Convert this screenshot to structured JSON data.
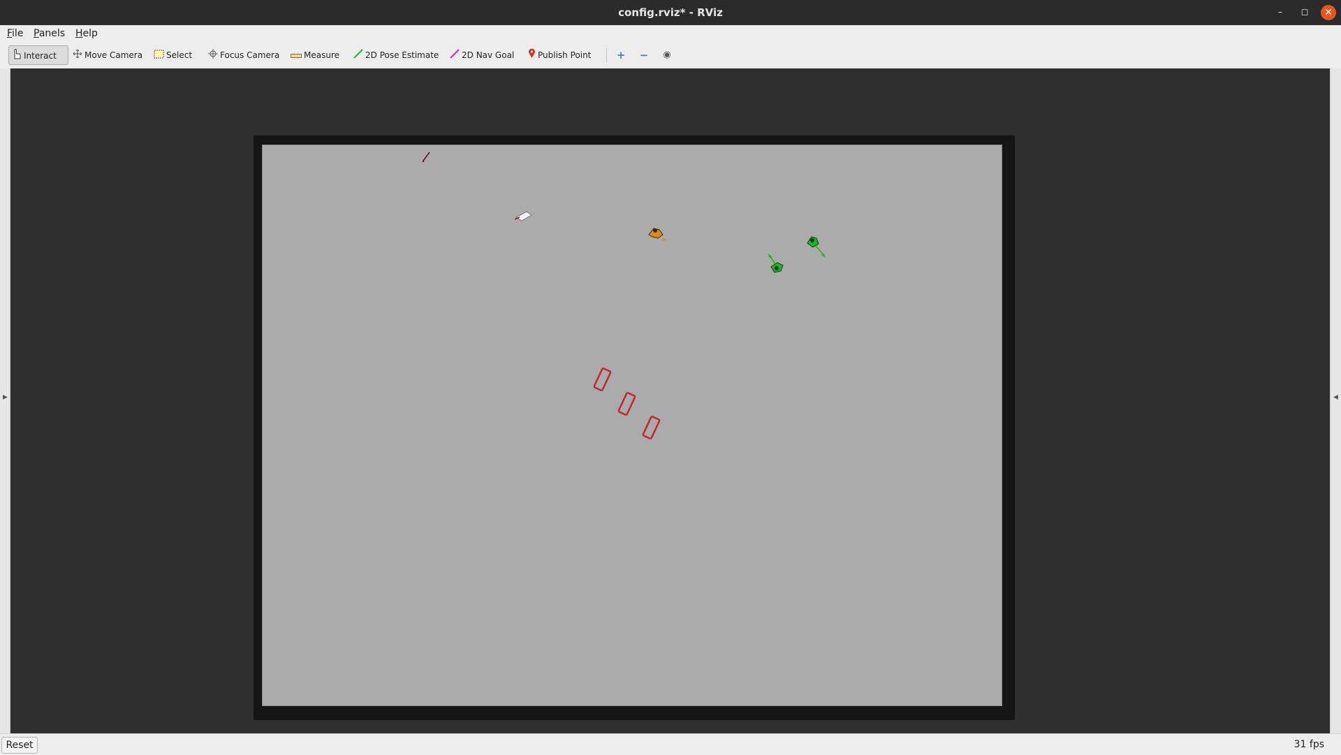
{
  "window": {
    "title": "config.rviz* - RViz",
    "minimize": "–",
    "maximize": "◻",
    "close": "✕"
  },
  "menu": [
    {
      "label": "File"
    },
    {
      "label": "Panels"
    },
    {
      "label": "Help"
    }
  ],
  "toolbar": {
    "tools": [
      {
        "label": "Interact",
        "icon": "hand-pointer-icon",
        "active": true
      },
      {
        "label": "Move Camera",
        "icon": "move-arrows-icon"
      },
      {
        "label": "Select",
        "icon": "select-rectangle-icon"
      },
      {
        "label": "Focus Camera",
        "icon": "crosshair-icon"
      },
      {
        "label": "Measure",
        "icon": "ruler-icon"
      },
      {
        "label": "2D Pose Estimate",
        "icon": "green-arrow-icon",
        "color": "#2db52d"
      },
      {
        "label": "2D Nav Goal",
        "icon": "magenta-arrow-icon",
        "color": "#d02bd0"
      },
      {
        "label": "Publish Point",
        "icon": "map-pin-icon",
        "color": "#d0341e"
      }
    ],
    "add_glyph": "+",
    "remove_glyph": "−",
    "eye_glyph": "◉"
  },
  "status": {
    "reset_label": "Reset",
    "fps": "31 fps"
  },
  "colors": {
    "map_floor": "#ababab",
    "map_border": "#151515",
    "obstacle": "#c0282a",
    "pedestrian_green": "#1fb51f",
    "pedestrian_orange": "#e08a12"
  }
}
